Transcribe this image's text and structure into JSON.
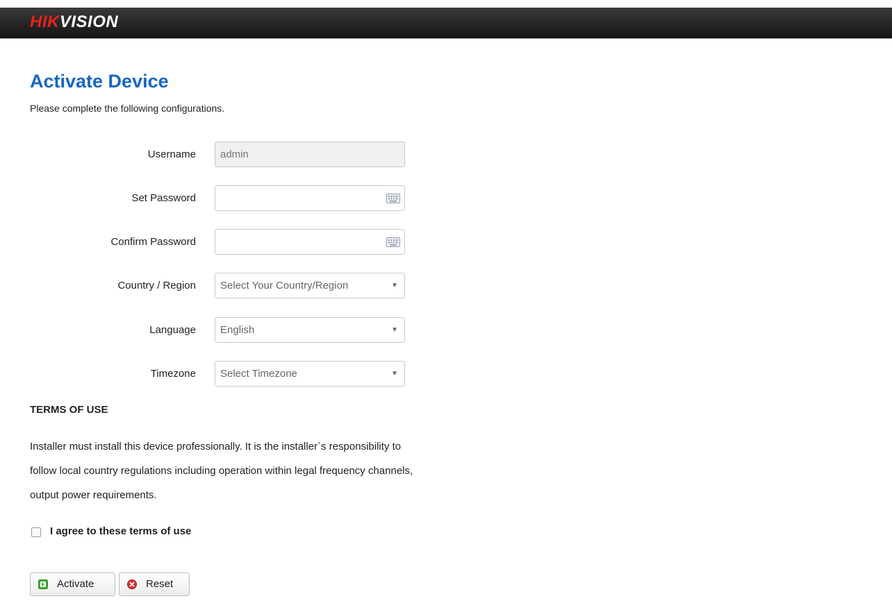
{
  "brand": {
    "logo_red": "HIK",
    "logo_white": "VISION"
  },
  "page": {
    "title": "Activate Device",
    "subtitle": "Please complete the following configurations."
  },
  "form": {
    "username": {
      "label": "Username",
      "value": "admin"
    },
    "set_password": {
      "label": "Set Password",
      "value": "",
      "icon": "keyboard-icon"
    },
    "confirm_password": {
      "label": "Confirm Password",
      "value": "",
      "icon": "keyboard-icon"
    },
    "country": {
      "label": "Country / Region",
      "selected": "Select Your Country/Region"
    },
    "language": {
      "label": "Language",
      "selected": "English"
    },
    "timezone": {
      "label": "Timezone",
      "selected": "Select Timezone"
    }
  },
  "terms": {
    "heading": "TERMS OF USE",
    "lines": [
      "Installer must install this device professionally. It is the installer`s responsibility to",
      "follow local country regulations including operation within legal frequency channels,",
      "output power requirements."
    ],
    "agree_label": "I agree to these terms of use",
    "agree_checked": false
  },
  "buttons": {
    "activate": {
      "label": "Activate",
      "icon": "play-icon"
    },
    "reset": {
      "label": "Reset",
      "icon": "close-icon"
    }
  },
  "colors": {
    "title_blue": "#1667c4",
    "logo_red": "#e2231a",
    "topbar": "#1f1f1f",
    "activate_icon": "#3cae2f",
    "reset_icon": "#d9302b"
  }
}
